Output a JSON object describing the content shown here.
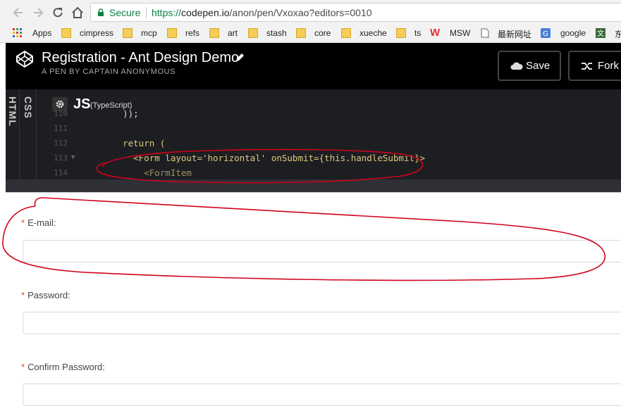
{
  "browser": {
    "secure_label": "Secure",
    "url_scheme": "https://",
    "url_host": "codepen.io",
    "url_path": "/anon/pen/Vxoxao?editors=0010",
    "bookmarks": [
      {
        "label": "Apps",
        "icon": "apps-grid-icon"
      },
      {
        "label": "cimpress",
        "icon": "folder-icon"
      },
      {
        "label": "mcp",
        "icon": "folder-icon"
      },
      {
        "label": "refs",
        "icon": "folder-icon"
      },
      {
        "label": "art",
        "icon": "folder-icon"
      },
      {
        "label": "stash",
        "icon": "folder-icon"
      },
      {
        "label": "core",
        "icon": "folder-icon"
      },
      {
        "label": "xueche",
        "icon": "folder-icon"
      },
      {
        "label": "ts",
        "icon": "folder-icon"
      },
      {
        "label": "MSW",
        "icon": "w-logo-icon"
      },
      {
        "label": "最新网址",
        "icon": "page-icon"
      },
      {
        "label": "google",
        "icon": "google-translate-icon"
      },
      {
        "label": "东",
        "icon": "wen-icon"
      }
    ]
  },
  "header": {
    "title": "Registration - Ant Design Demo",
    "subtitle": "A PEN BY CAPTAIN ANONYMOUS",
    "save_label": "Save",
    "fork_label": "Fork"
  },
  "editor": {
    "html_tab": "HTML",
    "css_tab": "CSS",
    "js_title": "JS",
    "js_subtitle": "(TypeScript)",
    "lines": [
      {
        "num": "110",
        "text": "    ));"
      },
      {
        "num": "111",
        "text": ""
      },
      {
        "num": "112",
        "text": "    return ("
      },
      {
        "num": "113",
        "text": "      <Form layout='horizontal' onSubmit={this.handleSubmit}>"
      },
      {
        "num": "114",
        "text": "        <FormItem"
      }
    ]
  },
  "form": {
    "fields": [
      {
        "label": "E-mail",
        "value": ""
      },
      {
        "label": "Password",
        "value": ""
      },
      {
        "label": "Confirm Password",
        "value": ""
      }
    ]
  },
  "colors": {
    "annotation": "#d0021b",
    "required": "#f04134",
    "secure_green": "#0b8043"
  }
}
